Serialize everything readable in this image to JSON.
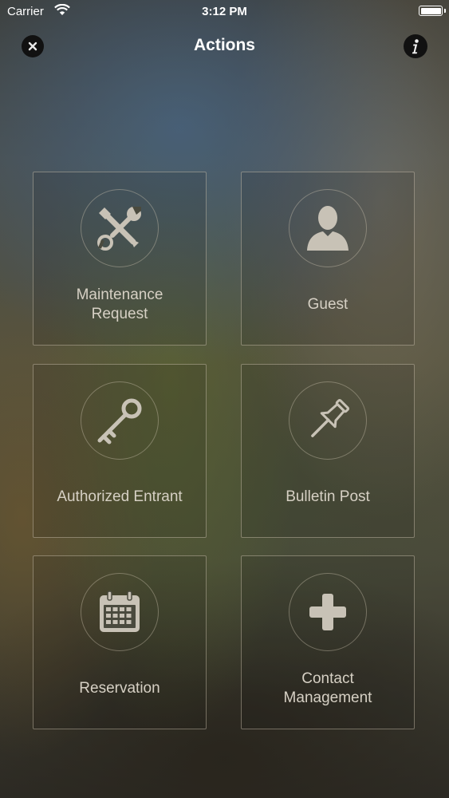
{
  "status_bar": {
    "carrier": "Carrier",
    "time": "3:12 PM"
  },
  "nav": {
    "title": "Actions",
    "close_icon": "close-icon",
    "info_icon": "info-icon"
  },
  "tiles": [
    {
      "label": "Maintenance\nRequest",
      "icon": "tools-icon"
    },
    {
      "label": "Guest",
      "icon": "person-icon"
    },
    {
      "label": "Authorized Entrant",
      "icon": "key-icon"
    },
    {
      "label": "Bulletin Post",
      "icon": "pushpin-icon"
    },
    {
      "label": "Reservation",
      "icon": "calendar-icon"
    },
    {
      "label": "Contact\nManagement",
      "icon": "plus-icon"
    }
  ],
  "colors": {
    "tile_icon": "#c8c2b6",
    "tile_label": "#d6d0c4",
    "tile_border": "#d2c8b4"
  }
}
